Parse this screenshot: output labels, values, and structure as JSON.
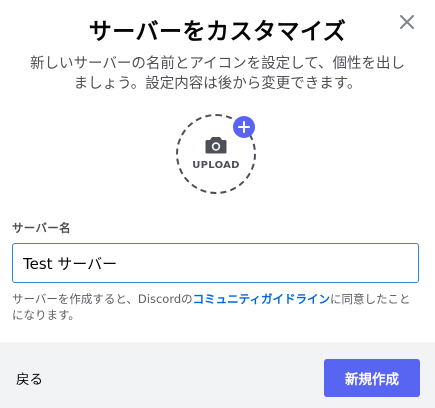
{
  "modal": {
    "title": "サーバーをカスタマイズ",
    "subtitle": "新しいサーバーの名前とアイコンを設定して、個性を出しましょう。設定内容は後から変更できます。",
    "close_icon": "close-icon"
  },
  "upload": {
    "label": "UPLOAD",
    "camera_icon": "camera-icon",
    "plus_icon": "plus-icon"
  },
  "server_name": {
    "label": "サーバー名",
    "value": "Test サーバー"
  },
  "disclaimer": {
    "prefix": "サーバーを作成すると、Discordの",
    "link": "コミュニティガイドライン",
    "suffix": "に同意したことになります。"
  },
  "footer": {
    "back_label": "戻る",
    "create_label": "新規作成"
  },
  "colors": {
    "accent": "#5865f2",
    "link": "#0068e0",
    "input_focus_border": "#2e8bd6",
    "footer_bg": "#f2f3f5"
  }
}
